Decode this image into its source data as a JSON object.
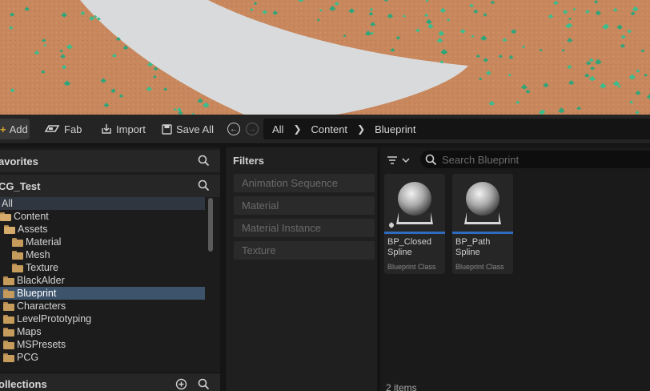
{
  "toolbar": {
    "add_label": "Add",
    "fab_label": "Fab",
    "import_label": "Import",
    "saveall_label": "Save All",
    "breadcrumb": [
      "All",
      "Content",
      "Blueprint"
    ]
  },
  "left_panel": {
    "favorites_label": "avorites",
    "project_label": "CG_Test",
    "collections_label": "ollections",
    "tree": [
      {
        "label": "All",
        "indent": 0,
        "type": "all"
      },
      {
        "label": "Content",
        "indent": 0,
        "type": "open"
      },
      {
        "label": "Assets",
        "indent": 1,
        "type": "open"
      },
      {
        "label": "Material",
        "indent": 2,
        "type": "closed"
      },
      {
        "label": "Mesh",
        "indent": 2,
        "type": "closed"
      },
      {
        "label": "Texture",
        "indent": 2,
        "type": "closed"
      },
      {
        "label": "BlackAlder",
        "indent": 1,
        "type": "closed"
      },
      {
        "label": "Blueprint",
        "indent": 1,
        "type": "closed",
        "selected": true
      },
      {
        "label": "Characters",
        "indent": 1,
        "type": "closed"
      },
      {
        "label": "LevelPrototyping",
        "indent": 1,
        "type": "closed"
      },
      {
        "label": "Maps",
        "indent": 1,
        "type": "closed"
      },
      {
        "label": "MSPresets",
        "indent": 1,
        "type": "closed"
      },
      {
        "label": "PCG",
        "indent": 1,
        "type": "closed"
      }
    ]
  },
  "filters": {
    "title": "Filters",
    "items": [
      "Animation Sequence",
      "Material",
      "Material Instance",
      "Texture"
    ]
  },
  "content": {
    "search_placeholder": "Search Blueprint",
    "assets": [
      {
        "name": "BP_Closed Spline",
        "type": "Blueprint Class"
      },
      {
        "name": "BP_Path Spline",
        "type": "Blueprint Class"
      }
    ],
    "items_count": "2 items"
  },
  "colors": {
    "accent_blue": "#2f6cc0",
    "selected_row": "#3c536b",
    "folder": "#c69c5d",
    "add_plus": "#d9a92b"
  }
}
